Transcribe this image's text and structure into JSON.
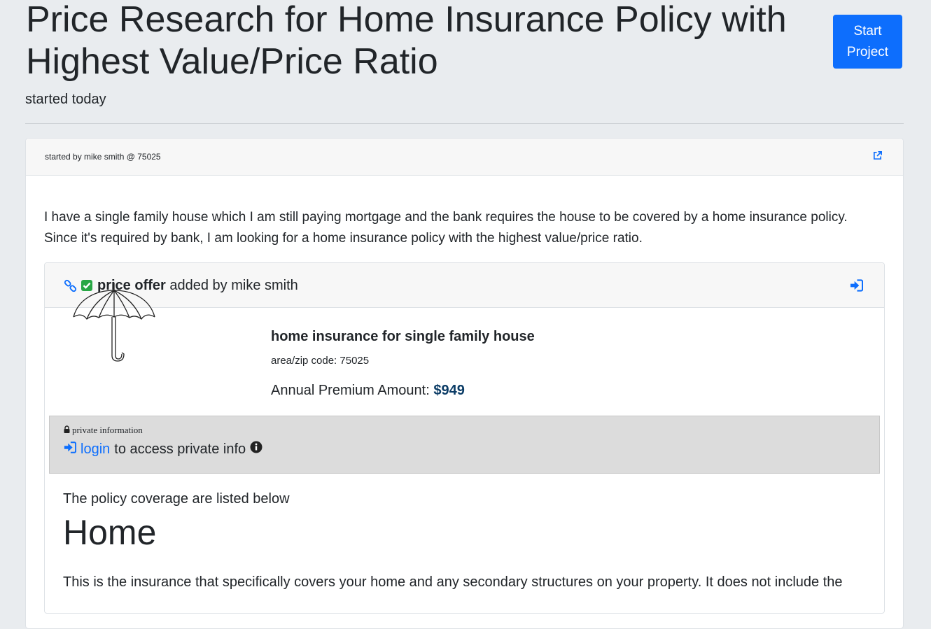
{
  "header": {
    "title": "Price Research for Home Insurance Policy with Highest Value/Price Ratio",
    "subtitle": "started today",
    "start_button_label": "Start Project"
  },
  "card": {
    "started_by": "started by mike smith @ 75025",
    "description": "I have a single family house which I am still paying mortgage and the bank requires the house to be covered by a home insurance policy. Since it's required by bank, I am looking for a home insurance policy with the highest value/price ratio.",
    "offer": {
      "type_label": "price offer",
      "added_by": " added by mike smith",
      "product_name": "home insurance for single family house",
      "zip": "area/zip code: 75025",
      "premium_label": "Annual Premium Amount: ",
      "premium_amount": "$949",
      "private_label": "private information",
      "login_link": "login",
      "login_suffix": "to access private info",
      "coverage_intro": "The policy coverage are listed below",
      "section_heading": "Home",
      "section_text": "This is the insurance that specifically covers your home and any secondary structures on your property. It does not include the"
    }
  },
  "colors": {
    "primary": "#0d6efd",
    "check_green": "#28a745",
    "premium": "#0b3c66",
    "background": "#e9ecef",
    "private_bg": "#dcdcdc"
  },
  "icons": {
    "link": "link-icon",
    "check": "check-square-icon",
    "signin": "sign-in-icon",
    "external": "external-link-icon",
    "lock": "lock-icon",
    "info": "info-circle-icon",
    "umbrella": "umbrella-icon"
  }
}
